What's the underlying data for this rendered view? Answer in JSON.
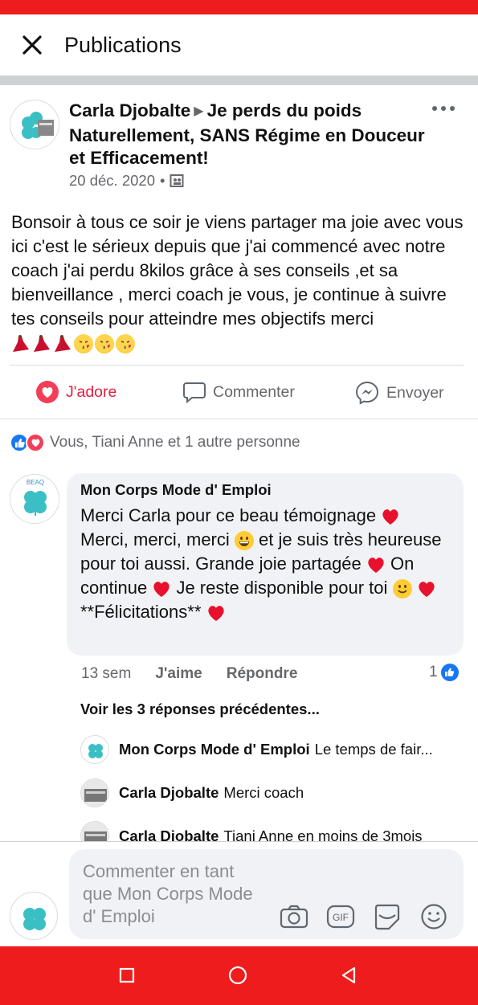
{
  "header": {
    "title": "Publications"
  },
  "post": {
    "author": "Carla Djobalte",
    "group": "Je perds du poids Naturellement, SANS Régime en Douceur et Efficacement!",
    "date": "20 déc. 2020",
    "separator": "•",
    "body": "Bonsoir à tous ce soir je viens partager ma joie avec vous ici c'est le sérieux depuis que j'ai commencé avec notre coach j'ai perdu 8kilos grâce à ses conseils ,et sa bienveillance , merci coach je vous, je continue à suivre tes conseils pour atteindre mes objectifs merci"
  },
  "actions": {
    "love": "J'adore",
    "comment": "Commenter",
    "send": "Envoyer"
  },
  "reactions": {
    "summary": "Vous, Tiani Anne et 1 autre personne"
  },
  "comment": {
    "author": "Mon Corps Mode d' Emploi",
    "text_1": "Merci Carla pour ce beau témoignage",
    "text_2": "Merci, merci, merci",
    "text_3": "et je suis très heureuse pour toi aussi. Grande joie partagée",
    "text_4": "On continue",
    "text_5": "Je reste disponible pour toi",
    "text_6": "**Félicitations**",
    "time": "13 sem",
    "like": "J'aime",
    "reply": "Répondre",
    "like_count": "1"
  },
  "replies": {
    "view_previous": "Voir les 3 réponses précédentes...",
    "items": [
      {
        "author": "Mon Corps Mode d' Emploi",
        "text": "Le temps de fair..."
      },
      {
        "author": "Carla Djobalte",
        "text": "Merci coach"
      },
      {
        "author": "Carla Djobalte",
        "text": "Tiani Anne en moins de 3mois"
      }
    ]
  },
  "composer": {
    "placeholder": "Commenter en tant que Mon Corps Mode d' Emploi",
    "gif": "GIF"
  },
  "logo_text": "BEAQ",
  "colors": {
    "love": "#e41e3f",
    "like": "#1877f2",
    "nav": "#ee1c1c"
  }
}
